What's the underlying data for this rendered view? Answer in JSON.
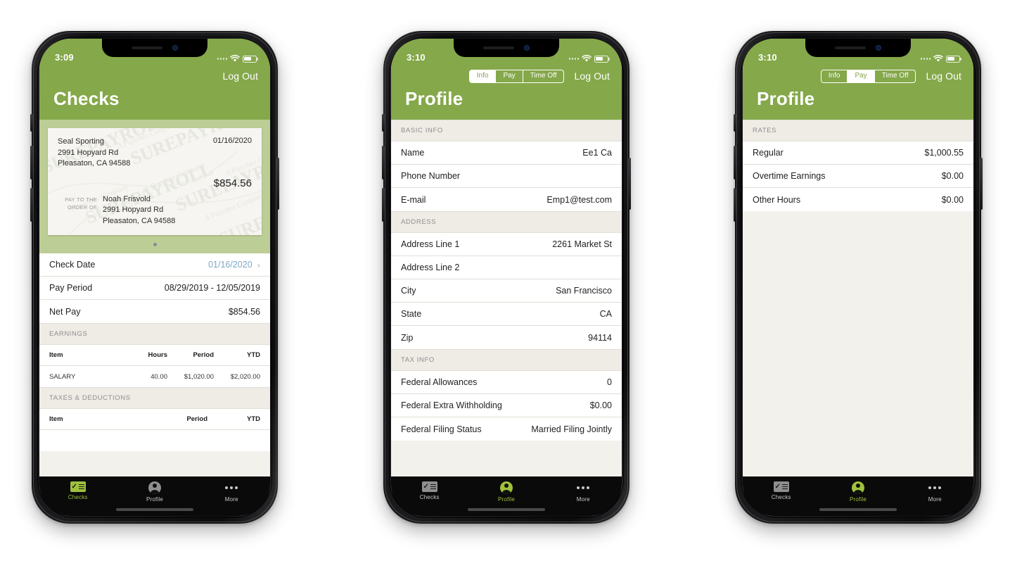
{
  "theme": {
    "green": "#85a84a",
    "green_light": "#bdcd96",
    "section_grey": "#efece6",
    "tab_active": "#9fc13c",
    "link_blue": "#7fa8c4"
  },
  "phones": [
    {
      "id": "phone-checks",
      "status": {
        "clock": "3:09"
      },
      "header": {
        "logout": "Log Out",
        "title": "Checks",
        "has_segmented": false
      },
      "check": {
        "watermark": "SUREPAYROLL",
        "watermark_sub": "A Paychex Company",
        "company_name": "Seal Sporting",
        "company_street": "2991 Hopyard Rd",
        "company_city": "Pleasaton, CA 94588",
        "date": "01/16/2020",
        "amount": "$854.56",
        "pay_to_label_1": "PAY TO THE",
        "pay_to_label_2": "ORDER OF",
        "payee_name": "Noah Frisvold",
        "payee_street": "2991 Hopyard Rd",
        "payee_city": "Pleasaton, CA 94588"
      },
      "detail_rows": [
        {
          "label": "Check Date",
          "value": "01/16/2020",
          "link": true,
          "chevron": "›"
        },
        {
          "label": "Pay Period",
          "value": "08/29/2019 - 12/05/2019",
          "link": false
        },
        {
          "label": "Net Pay",
          "value": "$854.56",
          "link": false
        }
      ],
      "earnings": {
        "section": "EARNINGS",
        "columns": [
          "Item",
          "Hours",
          "Period",
          "YTD"
        ],
        "rows": [
          [
            "SALARY",
            "40.00",
            "$1,020.00",
            "$2,020.00"
          ]
        ]
      },
      "taxes": {
        "section": "TAXES & DEDUCTIONS",
        "columns": [
          "Item",
          "Period",
          "YTD"
        ],
        "rows": []
      },
      "tabs": [
        {
          "label": "Checks",
          "icon": "checks-icon",
          "active": true
        },
        {
          "label": "Profile",
          "icon": "profile-icon",
          "active": false
        },
        {
          "label": "More",
          "icon": "more-icon",
          "active": false
        }
      ]
    },
    {
      "id": "phone-profile-info",
      "status": {
        "clock": "3:10"
      },
      "header": {
        "logout": "Log Out",
        "title": "Profile",
        "has_segmented": true,
        "segments": [
          {
            "label": "Info",
            "active": true
          },
          {
            "label": "Pay",
            "active": false
          },
          {
            "label": "Time Off",
            "active": false
          }
        ]
      },
      "sections": [
        {
          "section": "BASIC INFO",
          "rows": [
            {
              "label": "Name",
              "value": "Ee1 Ca"
            },
            {
              "label": "Phone Number",
              "value": ""
            },
            {
              "label": "E-mail",
              "value": "Emp1@test.com"
            }
          ]
        },
        {
          "section": "ADDRESS",
          "rows": [
            {
              "label": "Address Line 1",
              "value": "2261 Market St"
            },
            {
              "label": "Address Line 2",
              "value": ""
            },
            {
              "label": "City",
              "value": "San Francisco"
            },
            {
              "label": "State",
              "value": "CA"
            },
            {
              "label": "Zip",
              "value": "94114"
            }
          ]
        },
        {
          "section": "TAX INFO",
          "rows": [
            {
              "label": "Federal Allowances",
              "value": "0"
            },
            {
              "label": "Federal Extra Withholding",
              "value": "$0.00"
            },
            {
              "label": "Federal Filing Status",
              "value": "Married Filing Jointly"
            }
          ]
        }
      ],
      "tabs": [
        {
          "label": "Checks",
          "icon": "checks-icon",
          "active": false
        },
        {
          "label": "Profile",
          "icon": "profile-icon",
          "active": true
        },
        {
          "label": "More",
          "icon": "more-icon",
          "active": false
        }
      ]
    },
    {
      "id": "phone-profile-pay",
      "status": {
        "clock": "3:10"
      },
      "header": {
        "logout": "Log Out",
        "title": "Profile",
        "has_segmented": true,
        "segments": [
          {
            "label": "Info",
            "active": false
          },
          {
            "label": "Pay",
            "active": true
          },
          {
            "label": "Time Off",
            "active": false
          }
        ]
      },
      "sections": [
        {
          "section": "RATES",
          "rows": [
            {
              "label": "Regular",
              "value": "$1,000.55"
            },
            {
              "label": "Overtime Earnings",
              "value": "$0.00"
            },
            {
              "label": "Other Hours",
              "value": "$0.00"
            }
          ]
        }
      ],
      "tabs": [
        {
          "label": "Checks",
          "icon": "checks-icon",
          "active": false
        },
        {
          "label": "Profile",
          "icon": "profile-icon",
          "active": true
        },
        {
          "label": "More",
          "icon": "more-icon",
          "active": false
        }
      ]
    }
  ]
}
